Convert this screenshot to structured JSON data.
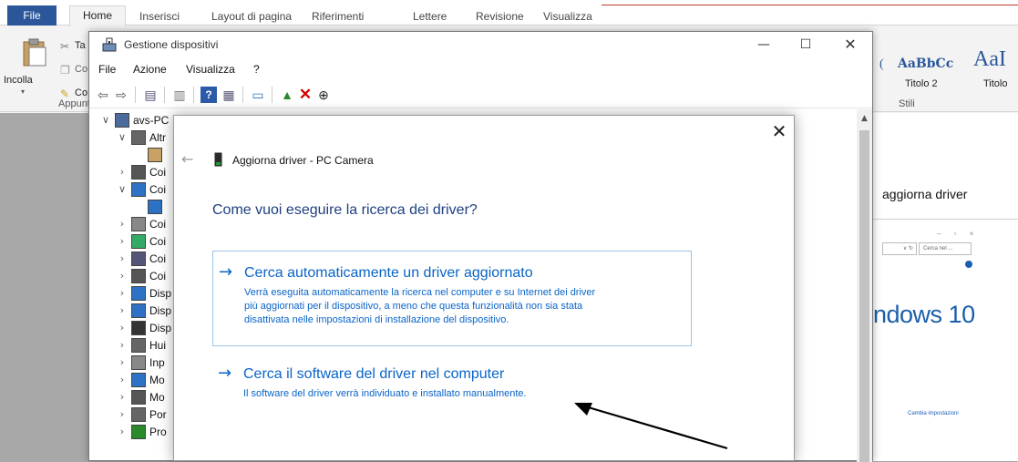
{
  "word": {
    "tabs": [
      "File",
      "Home",
      "Inserisci",
      "Layout di pagina",
      "Riferimenti",
      "Lettere",
      "Revisione",
      "Visualizza"
    ],
    "clipboard": {
      "paste_label": "Incolla",
      "group_label": "Appunti",
      "cut_label": "Ta",
      "copy_label": "Co",
      "format_label": "Co"
    },
    "styles": {
      "sample1": "AaBbCc",
      "sample2": "AaI",
      "name1": "Titolo 2",
      "name2": "Titolo",
      "group_label": "Stili",
      "left_char": "("
    },
    "document": {
      "heading": "aggiorna driver",
      "win10": "ndows 10",
      "search_placeholder": "Cerca nel ... ",
      "change_settings": "Cambia impostazioni"
    }
  },
  "device_manager": {
    "title": "Gestione dispositivi",
    "menus": [
      "File",
      "Azione",
      "Visualizza",
      "?"
    ],
    "tree": [
      {
        "level": 0,
        "expanded": "open",
        "label": "avs-PC"
      },
      {
        "level": 1,
        "expanded": "open",
        "label": "Altr"
      },
      {
        "level": 2,
        "expanded": "none",
        "label": ""
      },
      {
        "level": 1,
        "expanded": "closed",
        "label": "Coi"
      },
      {
        "level": 1,
        "expanded": "open",
        "label": "Coi"
      },
      {
        "level": 2,
        "expanded": "none",
        "label": ""
      },
      {
        "level": 1,
        "expanded": "closed",
        "label": "Coi"
      },
      {
        "level": 1,
        "expanded": "closed",
        "label": "Coi"
      },
      {
        "level": 1,
        "expanded": "closed",
        "label": "Coi"
      },
      {
        "level": 1,
        "expanded": "closed",
        "label": "Coi"
      },
      {
        "level": 1,
        "expanded": "closed",
        "label": "Disp"
      },
      {
        "level": 1,
        "expanded": "closed",
        "label": "Disp"
      },
      {
        "level": 1,
        "expanded": "closed",
        "label": "Disp"
      },
      {
        "level": 1,
        "expanded": "closed",
        "label": "Hui"
      },
      {
        "level": 1,
        "expanded": "closed",
        "label": "Inp"
      },
      {
        "level": 1,
        "expanded": "closed",
        "label": "Mo"
      },
      {
        "level": 1,
        "expanded": "closed",
        "label": "Mo"
      },
      {
        "level": 1,
        "expanded": "closed",
        "label": "Por"
      },
      {
        "level": 1,
        "expanded": "closed",
        "label": "Pro"
      }
    ]
  },
  "dialog": {
    "title": "Aggiorna driver - PC Camera",
    "question": "Come vuoi eseguire la ricerca dei driver?",
    "option1": {
      "title": "Cerca automaticamente un driver aggiornato",
      "desc_line1": "Verrà eseguita automaticamente la ricerca nel computer e su Internet dei driver",
      "desc_line2": "più aggiornati per il dispositivo, a meno che questa funzionalità non sia stata",
      "desc_line3": "disattivata nelle impostazioni di installazione del dispositivo."
    },
    "option2": {
      "title": "Cerca il software del driver nel computer",
      "desc": "Il software del driver verrà individuato e installato manualmente."
    }
  },
  "colors": {
    "word_blue": "#2b579a",
    "link_blue": "#0a64c8",
    "question_blue": "#1e3f80",
    "option_border": "#9cc3e6"
  }
}
